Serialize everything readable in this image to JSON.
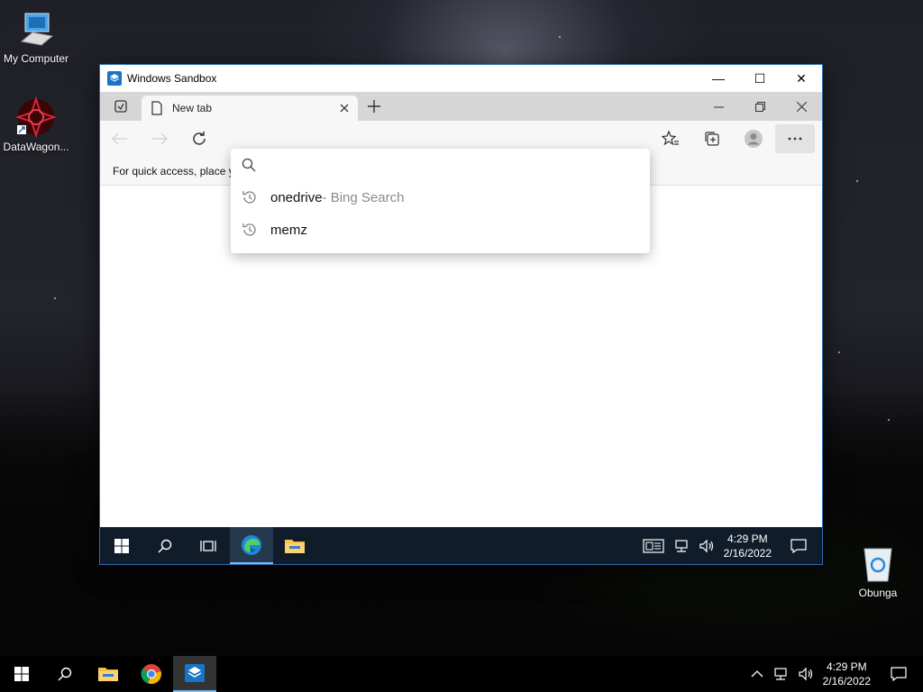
{
  "desktop": {
    "icons": [
      {
        "label": "My Computer",
        "icon": "computer-icon"
      },
      {
        "label": "DataWagon...",
        "icon": "datawagon-icon"
      },
      {
        "label": "Obunga",
        "icon": "recycle-bin-icon"
      }
    ]
  },
  "sandbox": {
    "title": "Windows Sandbox",
    "controls": {
      "minimize": "—",
      "maximize": "☐",
      "close": "✕"
    }
  },
  "edge": {
    "tab_title": "New tab",
    "favbar_text": "For quick access, place y",
    "omnibox": {
      "value": "",
      "placeholder": "",
      "suggestions": [
        {
          "text": "onedrive",
          "suffix": " - Bing Search"
        },
        {
          "text": "memz",
          "suffix": ""
        }
      ]
    }
  },
  "inner_taskbar": {
    "time": "4:29 PM",
    "date": "2/16/2022"
  },
  "taskbar": {
    "time": "4:29 PM",
    "date": "2/16/2022"
  },
  "colors": {
    "accent": "#76b9ed",
    "sandbox_blue": "#1a73c8"
  }
}
